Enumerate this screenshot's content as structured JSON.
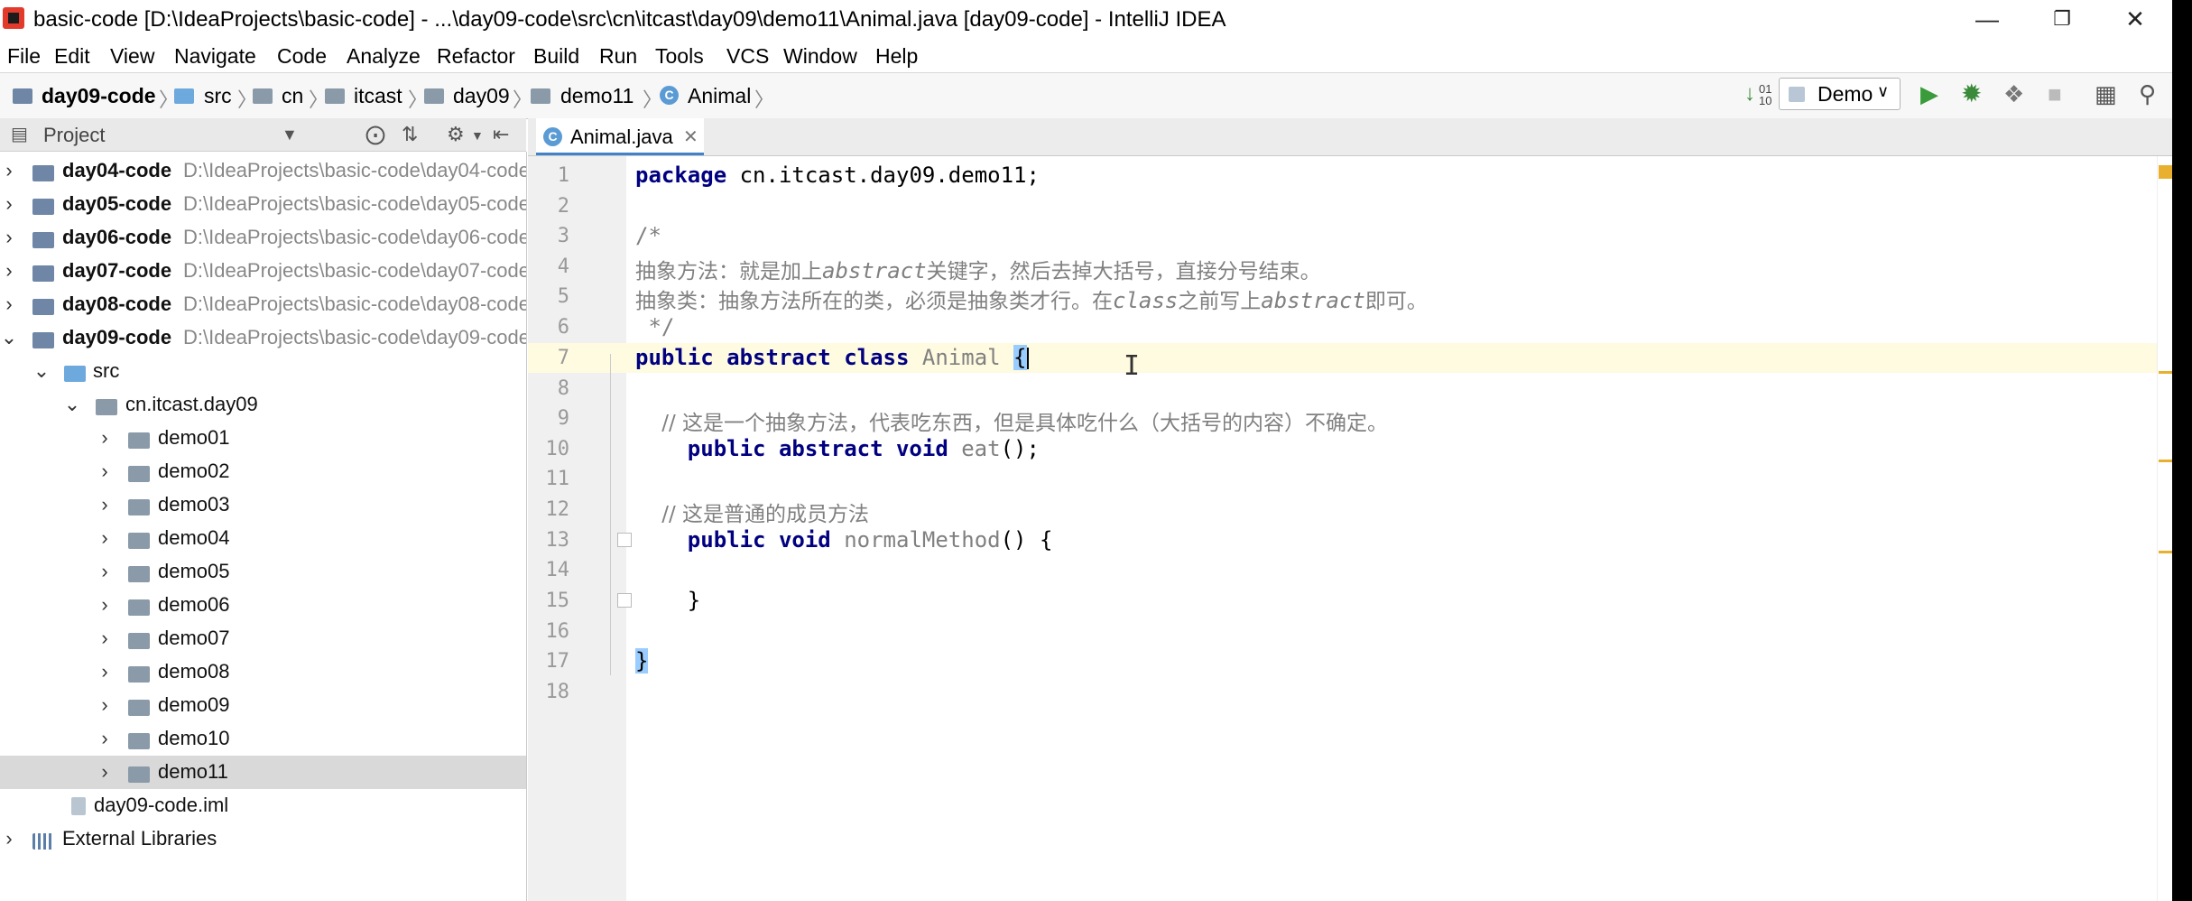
{
  "window": {
    "title": "basic-code [D:\\IdeaProjects\\basic-code] - ...\\day09-code\\src\\cn\\itcast\\day09\\demo11\\Animal.java [day09-code] - IntelliJ IDEA",
    "minimize_icon": "minimize-icon",
    "maximize_icon": "restore-icon",
    "close_icon": "close-icon"
  },
  "menu": [
    "File",
    "Edit",
    "View",
    "Navigate",
    "Code",
    "Analyze",
    "Refactor",
    "Build",
    "Run",
    "Tools",
    "VCS",
    "Window",
    "Help"
  ],
  "breadcrumbs": [
    "day09-code",
    "src",
    "cn",
    "itcast",
    "day09",
    "demo11",
    "Animal"
  ],
  "run_config": {
    "label": "Demo"
  },
  "project_panel": {
    "title": "Project",
    "tree": [
      {
        "name": "day04-code",
        "path": "D:\\IdeaProjects\\basic-code\\day04-code"
      },
      {
        "name": "day05-code",
        "path": "D:\\IdeaProjects\\basic-code\\day05-code"
      },
      {
        "name": "day06-code",
        "path": "D:\\IdeaProjects\\basic-code\\day06-code"
      },
      {
        "name": "day07-code",
        "path": "D:\\IdeaProjects\\basic-code\\day07-code"
      },
      {
        "name": "day08-code",
        "path": "D:\\IdeaProjects\\basic-code\\day08-code"
      },
      {
        "name": "day09-code",
        "path": "D:\\IdeaProjects\\basic-code\\day09-code"
      },
      {
        "name": "src"
      },
      {
        "name": "cn.itcast.day09"
      },
      {
        "name": "demo01"
      },
      {
        "name": "demo02"
      },
      {
        "name": "demo03"
      },
      {
        "name": "demo04"
      },
      {
        "name": "demo05"
      },
      {
        "name": "demo06"
      },
      {
        "name": "demo07"
      },
      {
        "name": "demo08"
      },
      {
        "name": "demo09"
      },
      {
        "name": "demo10"
      },
      {
        "name": "demo11"
      },
      {
        "name": "day09-code.iml"
      },
      {
        "name": "External Libraries"
      }
    ]
  },
  "editor": {
    "tab": {
      "label": "Animal.java"
    },
    "line_numbers": [
      "1",
      "2",
      "3",
      "4",
      "5",
      "6",
      "7",
      "8",
      "9",
      "10",
      "11",
      "12",
      "13",
      "14",
      "15",
      "16",
      "17",
      "18"
    ],
    "code": {
      "l1_kw": "package",
      "l1_rest": " cn.itcast.day09.demo11;",
      "l3": "/*",
      "l4_a": "抽象方法：就是加上",
      "l4_b": "abstract",
      "l4_c": "关键字，然后去掉大括号，直接分号结束。",
      "l5_a": "抽象类：抽象方法所在的类，必须是抽象类才行。在",
      "l5_b": "class",
      "l5_c": "之前写上",
      "l5_d": "abstract",
      "l5_e": "即可。",
      "l6": " */",
      "l7_kw": "public abstract class",
      "l7_cls": "Animal",
      "l7_brace": "{",
      "l9": "    // 这是一个抽象方法，代表吃东西，但是具体吃什么（大括号的内容）不确定。",
      "l10_kw": "    public abstract void",
      "l10_m": "eat",
      "l10_rest": "();",
      "l12": "    // 这是普通的成员方法",
      "l13_kw": "    public void",
      "l13_m": "normalMethod",
      "l13_rest": "() {",
      "l15": "    }",
      "l17": "}"
    }
  },
  "colors": {
    "keyword": "#000080",
    "comment": "#808080",
    "selection": "#d9d9d9",
    "current_line": "#fffbe0",
    "brace_match": "#99ccff"
  }
}
